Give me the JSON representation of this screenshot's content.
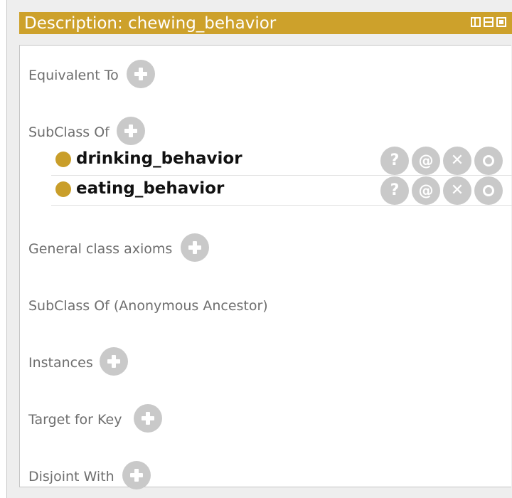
{
  "colors": {
    "title_bar": "#cda12b",
    "class_icon": "#c99e2a",
    "button": "#c9c9c9",
    "section_text": "#6e6e6e"
  },
  "title": "Description: chewing_behavior",
  "view_controls": [
    "view-toggle-icon",
    "view-split-icon",
    "view-close-icon"
  ],
  "sections": {
    "equivalent_to": "Equivalent To",
    "subclass_of": "SubClass Of",
    "general_class_axioms": "General class axioms",
    "subclass_of_anonymous": "SubClass Of (Anonymous Ancestor)",
    "instances": "Instances",
    "target_for_key": "Target for Key",
    "disjoint_with": "Disjoint With"
  },
  "subclass_items": [
    {
      "label": "drinking_behavior"
    },
    {
      "label": "eating_behavior"
    }
  ],
  "row_actions": {
    "explain": "?",
    "annotate": "@",
    "delete": "✕",
    "edit_icon": "edit-icon"
  }
}
